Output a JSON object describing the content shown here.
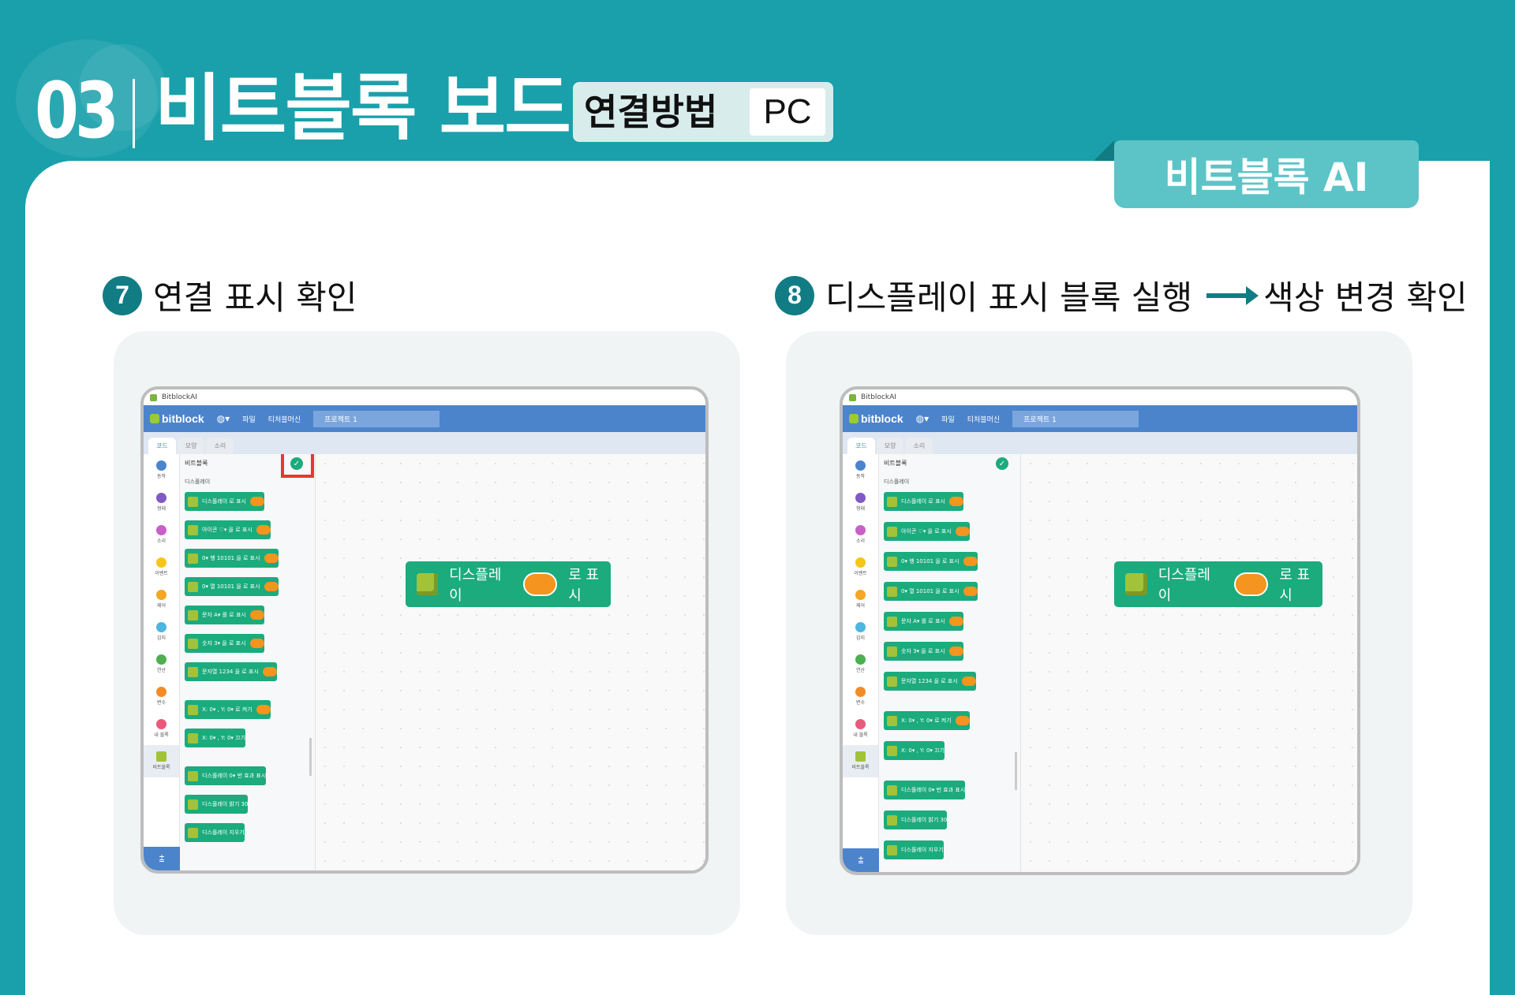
{
  "header": {
    "number": "03",
    "title": "비트블록 보드",
    "method": "연결방법",
    "platform": "PC"
  },
  "tab": {
    "label": "비트블록 AI"
  },
  "steps": [
    {
      "num": "7",
      "title": "연결 표시 확인"
    },
    {
      "num": "8",
      "title_a": "디스플레이 표시 블록 실행",
      "title_b": "색상 변경 확인"
    }
  ],
  "shot1": {
    "window_title": "BitblockAI",
    "logo": "bitblock",
    "menu_file": "파일",
    "menu_teach": "티처블머신",
    "project": "프로젝트 1",
    "tabs": [
      "코드",
      "모양",
      "소리"
    ],
    "categories": [
      "동작",
      "형태",
      "소리",
      "이벤트",
      "제어",
      "감지",
      "연산",
      "변수",
      "내 블록",
      "비트블록"
    ],
    "palette_title": "비트블록",
    "palette_sub": "디스플레이",
    "blocks": [
      "디스플레이 로 표시",
      "아이콘 ♡▾ 을 로 표시",
      "0▾ 행 10101 을 로 표시",
      "0▾ 열 10101 을 로 표시",
      "문자 A▾ 를 로 표시",
      "숫자 3▾ 을 로 표시",
      "문자열 1234 을 로 표시",
      "X: 0▾ , Y: 0▾ 로 켜기",
      "X: 0▾ , Y: 0▾ 끄기",
      "디스플레이 0▾ 번 효과 표시",
      "디스플레이 밝기 30",
      "디스플레이 지우기"
    ],
    "main_block_a": "디스플레이",
    "main_block_b": "로 표시"
  },
  "shot2": {
    "window_title": "BitblockAI",
    "logo": "bitblock",
    "menu_file": "파일",
    "menu_teach": "티처블머신",
    "project": "프로젝트 1",
    "tabs": [
      "코드",
      "모양",
      "소리"
    ],
    "categories": [
      "동작",
      "형태",
      "소리",
      "이벤트",
      "제어",
      "감지",
      "연산",
      "변수",
      "내 블록",
      "비트블록"
    ],
    "palette_title": "비트블록",
    "palette_sub": "디스플레이",
    "blocks": [
      "디스플레이 로 표시",
      "아이콘 ♡▾ 을 로 표시",
      "0▾ 행 10101 을 로 표시",
      "0▾ 열 10101 을 로 표시",
      "문자 A▾ 를 로 표시",
      "숫자 3▾ 을 로 표시",
      "문자열 1234 을 로 표시",
      "X: 0▾ , Y: 0▾ 로 켜기",
      "X: 0▾ , Y: 0▾ 끄기",
      "디스플레이 0▾ 번 효과 표시",
      "디스플레이 밝기 30",
      "디스플레이 지우기"
    ],
    "main_block_a": "디스플레이",
    "main_block_b": "로 표시"
  },
  "colors": {
    "teal": "#1aa0ab",
    "dark_teal": "#117c83",
    "block_green": "#1bab7d",
    "orange": "#f5941e",
    "blue": "#4c84cc",
    "red": "#e53935"
  }
}
